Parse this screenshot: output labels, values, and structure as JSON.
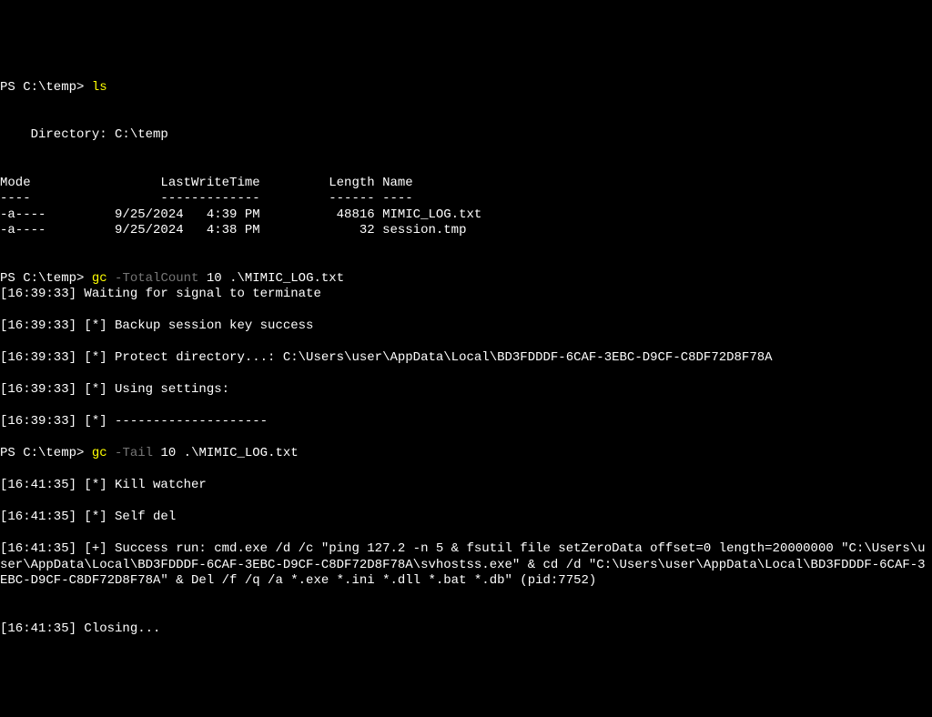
{
  "prompt1_prefix": "PS C:\\temp> ",
  "cmd1": "ls",
  "blank": "",
  "dir_header": "    Directory: C:\\temp",
  "table_header": "Mode                 LastWriteTime         Length Name",
  "table_divider": "----                 -------------         ------ ----",
  "row1": "-a----         9/25/2024   4:39 PM          48816 MIMIC_LOG.txt",
  "row2": "-a----         9/25/2024   4:38 PM             32 session.tmp",
  "prompt2_prefix": "PS C:\\temp> ",
  "cmd2_gc": "gc",
  "cmd2_param": " -TotalCount",
  "cmd2_rest": " 10 .\\MIMIC_LOG.txt",
  "log1": "[16:39:33] Waiting for signal to terminate",
  "log2": "[16:39:33] [*] Backup session key success",
  "log3": "[16:39:33] [*] Protect directory...: C:\\Users\\user\\AppData\\Local\\BD3FDDDF-6CAF-3EBC-D9CF-C8DF72D8F78A",
  "log4": "[16:39:33] [*] Using settings:",
  "log5": "[16:39:33] [*] --------------------",
  "prompt3_prefix": "PS C:\\temp> ",
  "cmd3_gc": "gc",
  "cmd3_param": " -Tail",
  "cmd3_rest": " 10 .\\MIMIC_LOG.txt",
  "log6": "[16:41:35] [*] Kill watcher",
  "log7": "[16:41:35] [*] Self del",
  "log8": "[16:41:35] [+] Success run: cmd.exe /d /c \"ping 127.2 -n 5 & fsutil file setZeroData offset=0 length=20000000 \"C:\\Users\\user\\AppData\\Local\\BD3FDDDF-6CAF-3EBC-D9CF-C8DF72D8F78A\\svhostss.exe\" & cd /d \"C:\\Users\\user\\AppData\\Local\\BD3FDDDF-6CAF-3EBC-D9CF-C8DF72D8F78A\" & Del /f /q /a *.exe *.ini *.dll *.bat *.db\" (pid:7752)",
  "log9": "[16:41:35] Closing..."
}
